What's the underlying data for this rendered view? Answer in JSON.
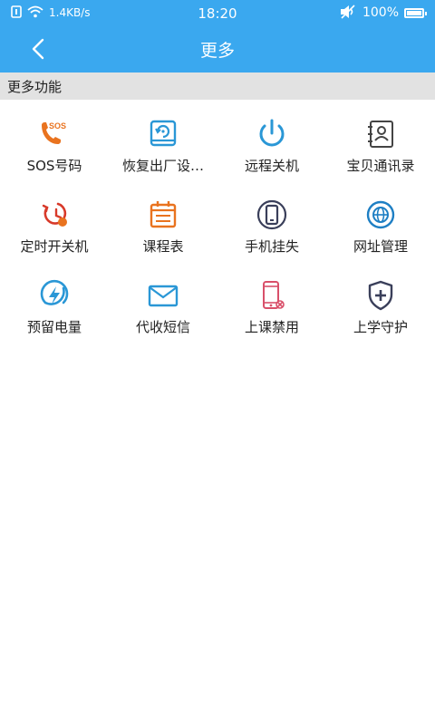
{
  "status_bar": {
    "net_speed": "1.4KB/s",
    "time": "18:20",
    "battery": "100%",
    "battery_level": 1.0
  },
  "header": {
    "title": "更多"
  },
  "section": {
    "title": "更多功能"
  },
  "features": [
    {
      "label": "SOS号码",
      "icon": "sos-phone-icon",
      "color": "#e9731f"
    },
    {
      "label": "恢复出厂设…",
      "icon": "factory-reset-icon",
      "color": "#2a97d6"
    },
    {
      "label": "远程关机",
      "icon": "power-icon",
      "color": "#2a97d6"
    },
    {
      "label": "宝贝通讯录",
      "icon": "contacts-icon",
      "color": "#444444"
    },
    {
      "label": "定时开关机",
      "icon": "timer-power-icon",
      "color": "#d83a2a"
    },
    {
      "label": "课程表",
      "icon": "calendar-icon",
      "color": "#e9731f"
    },
    {
      "label": "手机挂失",
      "icon": "phone-lost-icon",
      "color": "#3a3f5a"
    },
    {
      "label": "网址管理",
      "icon": "globe-icon",
      "color": "#1e7fc4"
    },
    {
      "label": "预留电量",
      "icon": "battery-bolt-icon",
      "color": "#2a97d6"
    },
    {
      "label": "代收短信",
      "icon": "envelope-icon",
      "color": "#2a97d6"
    },
    {
      "label": "上课禁用",
      "icon": "phone-disable-icon",
      "color": "#d9506a"
    },
    {
      "label": "上学守护",
      "icon": "shield-plus-icon",
      "color": "#3a3f5a"
    }
  ]
}
